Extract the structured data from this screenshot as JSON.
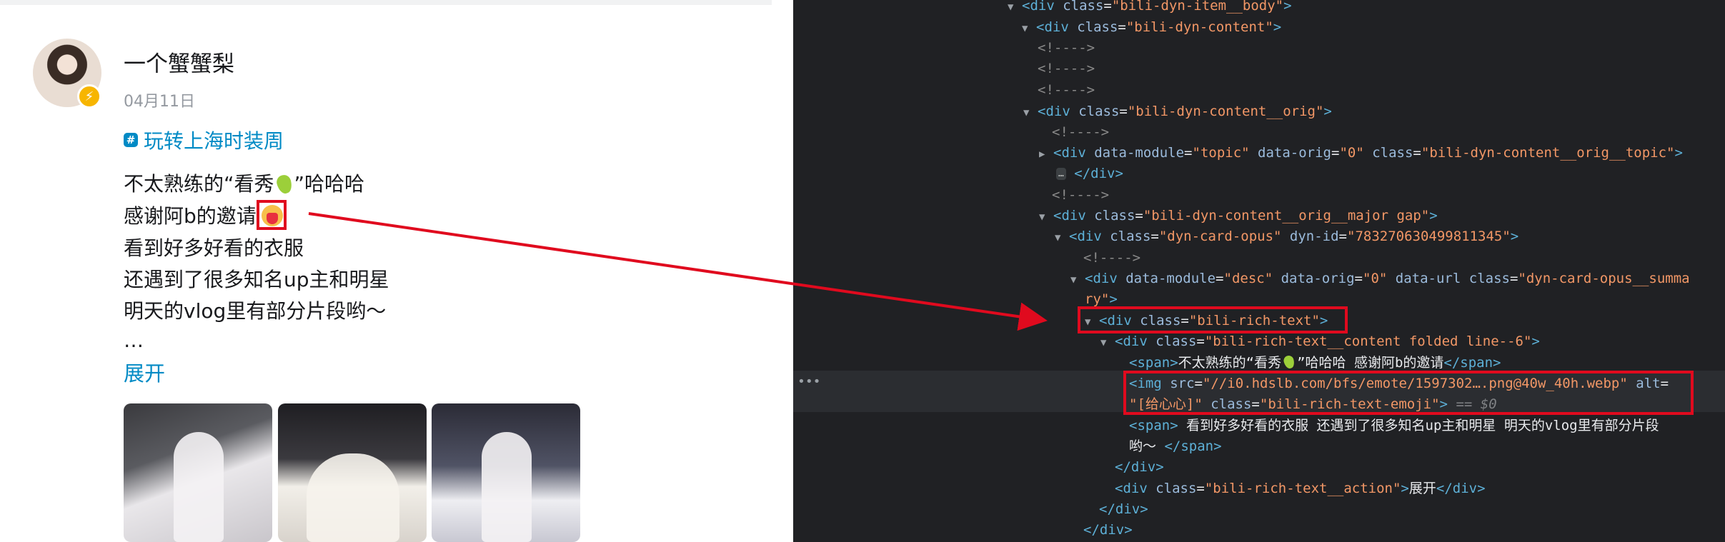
{
  "post": {
    "username": "一个蟹蟹梨",
    "date": "04月11日",
    "topic_icon": "#",
    "topic": "玩转上海时装周",
    "line1_a": "不太熟练的“看秀",
    "line1_b": "”哈哈哈",
    "line2": "感谢阿b的邀请",
    "line3": "看到好多好看的衣服",
    "line4": "还遇到了很多知名up主和明星",
    "line5": "明天的vlog里有部分片段哟～",
    "line6": "…",
    "expand": "展开",
    "badge_glyph": "⚡"
  },
  "devtools": {
    "l1": {
      "open": "<div ",
      "a": "class",
      "eq": "=",
      "v": "\"bili-dyn-item__body\"",
      "close": ">"
    },
    "l2": {
      "open": "<div ",
      "a": "class",
      "eq": "=",
      "v": "\"bili-dyn-content\"",
      "close": ">"
    },
    "comment": "<!---->",
    "l6": {
      "open": "<div ",
      "a": "class",
      "eq": "=",
      "v": "\"bili-dyn-content__orig\"",
      "close": ">"
    },
    "l8": {
      "open": "<div ",
      "a1": "data-module",
      "v1": "\"topic\"",
      "a2": "data-orig",
      "v2": "\"0\"",
      "a3": "class",
      "v3": "\"bili-dyn-content__orig__topic\"",
      "close": ">"
    },
    "l9_pill": "…",
    "l9_close": "</div>",
    "l11": {
      "open": "<div ",
      "a": "class",
      "eq": "=",
      "v": "\"bili-dyn-content__orig__major gap\"",
      "close": ">"
    },
    "l12": {
      "open": "<div ",
      "a1": "class",
      "v1": "\"dyn-card-opus\"",
      "a2": "dyn-id",
      "v2": "\"783270630499811345\"",
      "close": ">"
    },
    "l14": {
      "open": "<div ",
      "a1": "data-module",
      "v1": "\"desc\"",
      "a2": "data-orig",
      "v2": "\"0\"",
      "a3": "data-url",
      "a4": "class",
      "v4a": "\"dyn-card-opus__summa",
      "v4b": "ry\"",
      "close": ">"
    },
    "l16": {
      "open": "<div ",
      "a": "class",
      "eq": "=",
      "v": "\"bili-rich-text\"",
      "close": ">"
    },
    "l17": {
      "open": "<div ",
      "a": "class",
      "eq": "=",
      "v": "\"bili-rich-text__content folded line--6\"",
      "close": ">"
    },
    "l18": {
      "open": "<span>",
      "t1": "不太熟练的“看秀",
      "t2": "”哈哈哈 感谢阿b的邀请",
      "close": "</span>"
    },
    "l19": {
      "open": "<img ",
      "a1": "src",
      "v1": "\"//i0.hdslb.com/bfs/emote/1597302….png@40w_40h.webp\"",
      "a2": "alt",
      "eq": "="
    },
    "l20": {
      "v2": "\"[给心心]\"",
      "a3": "class",
      "v3": "\"bili-rich-text-emoji\"",
      "close": ">",
      "dollar": " == $0"
    },
    "l21": {
      "open": "<span>",
      "t": " 看到好多好看的衣服 还遇到了很多知名up主和明星 明天的vlog里有部分片段"
    },
    "l22": {
      "t": "哟～ ",
      "close": "</span>"
    },
    "l23": "</div>",
    "l24": {
      "open": "<div ",
      "a": "class",
      "eq": "=",
      "v": "\"bili-rich-text__action\"",
      "close": ">",
      "t": "展开",
      "end": "</div>"
    },
    "l25": "</div>",
    "l26": "</div>",
    "gutter_dots": "•••"
  },
  "colors": {
    "annotation_red": "#e00a1e",
    "link_blue": "#008ac5",
    "devtools_bg": "#202124"
  }
}
